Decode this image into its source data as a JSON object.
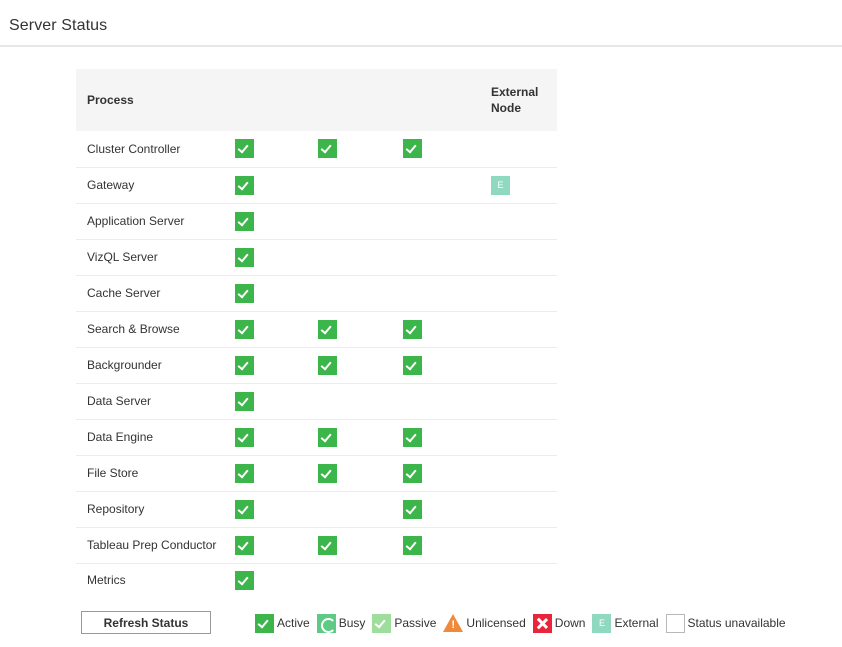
{
  "page": {
    "title": "Server Status"
  },
  "table": {
    "header": {
      "process": "Process",
      "external_line1": "External",
      "external_line2": "Node"
    },
    "rows": [
      {
        "name": "Cluster Controller",
        "cells": [
          "active",
          "active",
          "active",
          ""
        ]
      },
      {
        "name": "Gateway",
        "cells": [
          "active",
          "",
          "",
          "external"
        ]
      },
      {
        "name": "Application Server",
        "cells": [
          "active",
          "",
          "",
          ""
        ]
      },
      {
        "name": "VizQL Server",
        "cells": [
          "active",
          "",
          "",
          ""
        ]
      },
      {
        "name": "Cache Server",
        "cells": [
          "active",
          "",
          "",
          ""
        ]
      },
      {
        "name": "Search & Browse",
        "cells": [
          "active",
          "active",
          "active",
          ""
        ]
      },
      {
        "name": "Backgrounder",
        "cells": [
          "active",
          "active",
          "active",
          ""
        ]
      },
      {
        "name": "Data Server",
        "cells": [
          "active",
          "",
          "",
          ""
        ]
      },
      {
        "name": "Data Engine",
        "cells": [
          "active",
          "active",
          "active",
          ""
        ]
      },
      {
        "name": "File Store",
        "cells": [
          "active",
          "active",
          "active",
          ""
        ]
      },
      {
        "name": "Repository",
        "cells": [
          "active",
          "",
          "active",
          ""
        ]
      },
      {
        "name": "Tableau Prep Conductor",
        "cells": [
          "active",
          "active",
          "active",
          ""
        ]
      },
      {
        "name": "Metrics",
        "cells": [
          "active",
          "",
          "",
          ""
        ]
      }
    ]
  },
  "external_badge_letter": "E",
  "refresh_button": {
    "label": "Refresh Status"
  },
  "legend": [
    {
      "status": "active",
      "label": "Active",
      "icon": "check-icon"
    },
    {
      "status": "busy",
      "label": "Busy",
      "icon": "refresh-icon"
    },
    {
      "status": "passive",
      "label": "Passive",
      "icon": "check-icon"
    },
    {
      "status": "unlicensed",
      "label": "Unlicensed",
      "icon": "warning-icon"
    },
    {
      "status": "down",
      "label": "Down",
      "icon": "x-icon"
    },
    {
      "status": "external",
      "label": "External",
      "icon": "external-icon"
    },
    {
      "status": "unavailable",
      "label": "Status unavailable",
      "icon": "empty-box-icon"
    }
  ],
  "colors": {
    "active": "#3cb54a",
    "busy": "#5fca86",
    "passive": "#9edd9c",
    "unlicensed": "#f08a3a",
    "down": "#e7263b",
    "external": "#8fd9c0",
    "header_bg": "#f5f5f5"
  }
}
